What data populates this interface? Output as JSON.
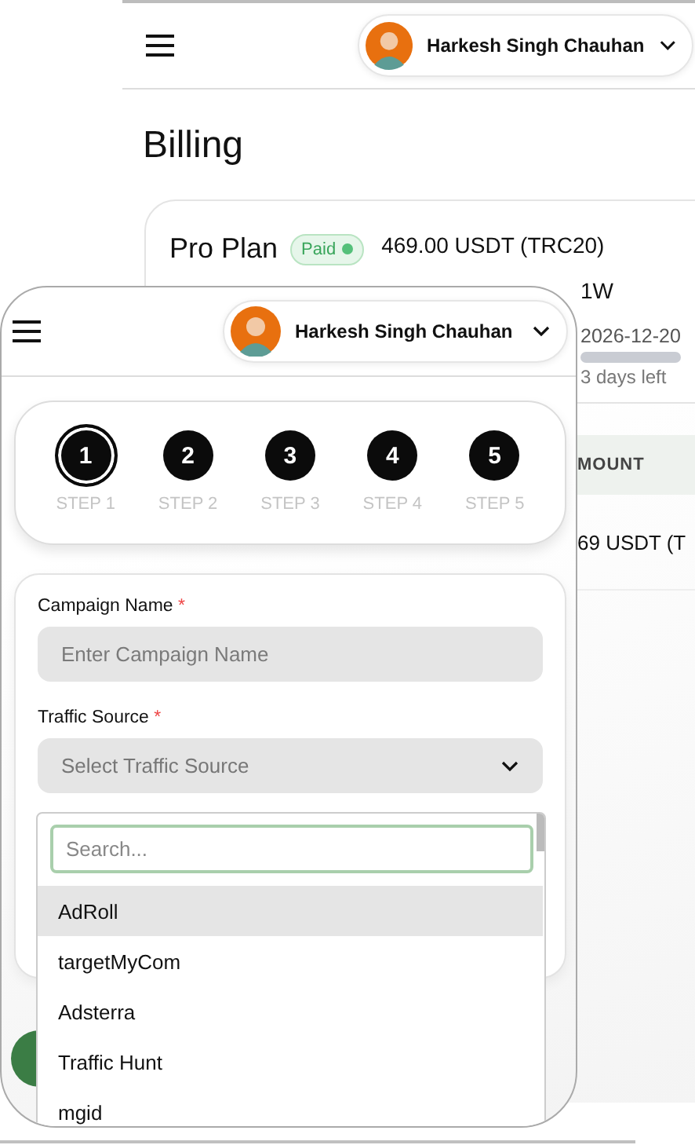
{
  "background_page": {
    "user_menu": {
      "name": "Harkesh Singh Chauhan"
    },
    "title": "Billing",
    "plan_card": {
      "name": "Pro Plan",
      "status": "Paid",
      "price": "469.00 USDT (TRC20)",
      "details": [
        "1W",
        "2026-12-20"
      ],
      "days_left": "3 days left"
    },
    "table": {
      "columns": [
        "MOUNT"
      ],
      "rows": [
        [
          "69 USDT (T"
        ]
      ]
    }
  },
  "campaign_window": {
    "user_menu": {
      "name": "Harkesh Singh Chauhan"
    },
    "steps": [
      {
        "number": "1",
        "label": "STEP 1",
        "selected": true
      },
      {
        "number": "2",
        "label": "STEP 2",
        "selected": false
      },
      {
        "number": "3",
        "label": "STEP 3",
        "selected": false
      },
      {
        "number": "4",
        "label": "STEP 4",
        "selected": false
      },
      {
        "number": "5",
        "label": "STEP 5",
        "selected": false
      }
    ],
    "fields": [
      {
        "kind": "text",
        "label": "Campaign Name",
        "required_mark": "*",
        "placeholder": "Enter Campaign Name"
      },
      {
        "kind": "select",
        "label": "Traffic Source",
        "required_mark": "*",
        "placeholder": "Select Traffic Source"
      }
    ],
    "dropdown": {
      "search_placeholder": "Search...",
      "options": [
        {
          "label": "AdRoll",
          "selected": true
        },
        {
          "label": "targetMyCom",
          "selected": false
        },
        {
          "label": "Adsterra",
          "selected": false
        },
        {
          "label": "Traffic Hunt",
          "selected": false
        },
        {
          "label": "mgid",
          "selected": false
        }
      ]
    }
  }
}
